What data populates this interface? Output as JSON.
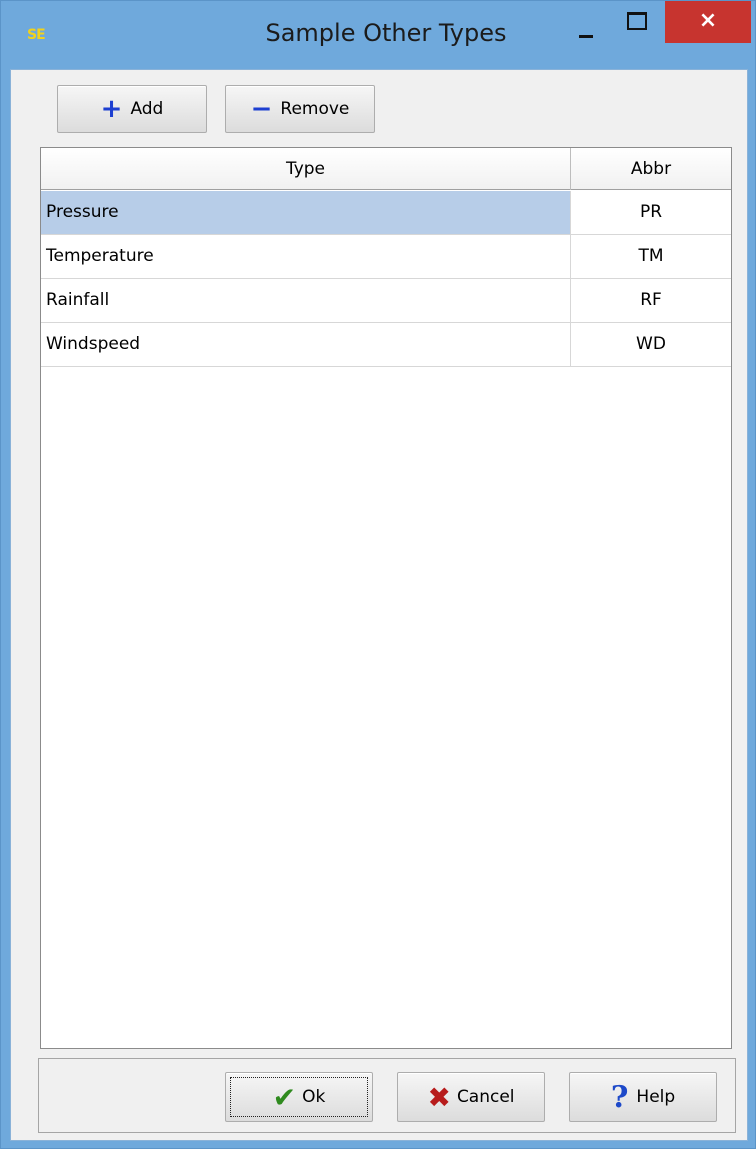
{
  "window": {
    "app_icon_text": "SE",
    "title": "Sample Other Types",
    "close_glyph": "×"
  },
  "toolbar": {
    "add_label": "Add",
    "remove_label": "Remove"
  },
  "table": {
    "columns": [
      "Type",
      "Abbr"
    ],
    "rows": [
      {
        "type": "Pressure",
        "abbr": "PR",
        "selected": true
      },
      {
        "type": "Temperature",
        "abbr": "TM",
        "selected": false
      },
      {
        "type": "Rainfall",
        "abbr": "RF",
        "selected": false
      },
      {
        "type": "Windspeed",
        "abbr": "WD",
        "selected": false
      }
    ]
  },
  "footer": {
    "ok_label": "Ok",
    "cancel_label": "Cancel",
    "help_label": "Help"
  },
  "colors": {
    "titlebar": "#6fa9dc",
    "close_button": "#c7342f",
    "selection": "#b7cde8",
    "add_icon": "#1d3fd1",
    "ok_icon": "#2f8a1e",
    "cancel_icon": "#b71b1b",
    "help_icon": "#1d49c9"
  },
  "icons": {
    "app": "app-logo-icon",
    "add": "plus-icon",
    "remove": "minus-icon",
    "ok": "checkmark-icon",
    "cancel": "x-icon",
    "help": "question-mark-icon"
  }
}
